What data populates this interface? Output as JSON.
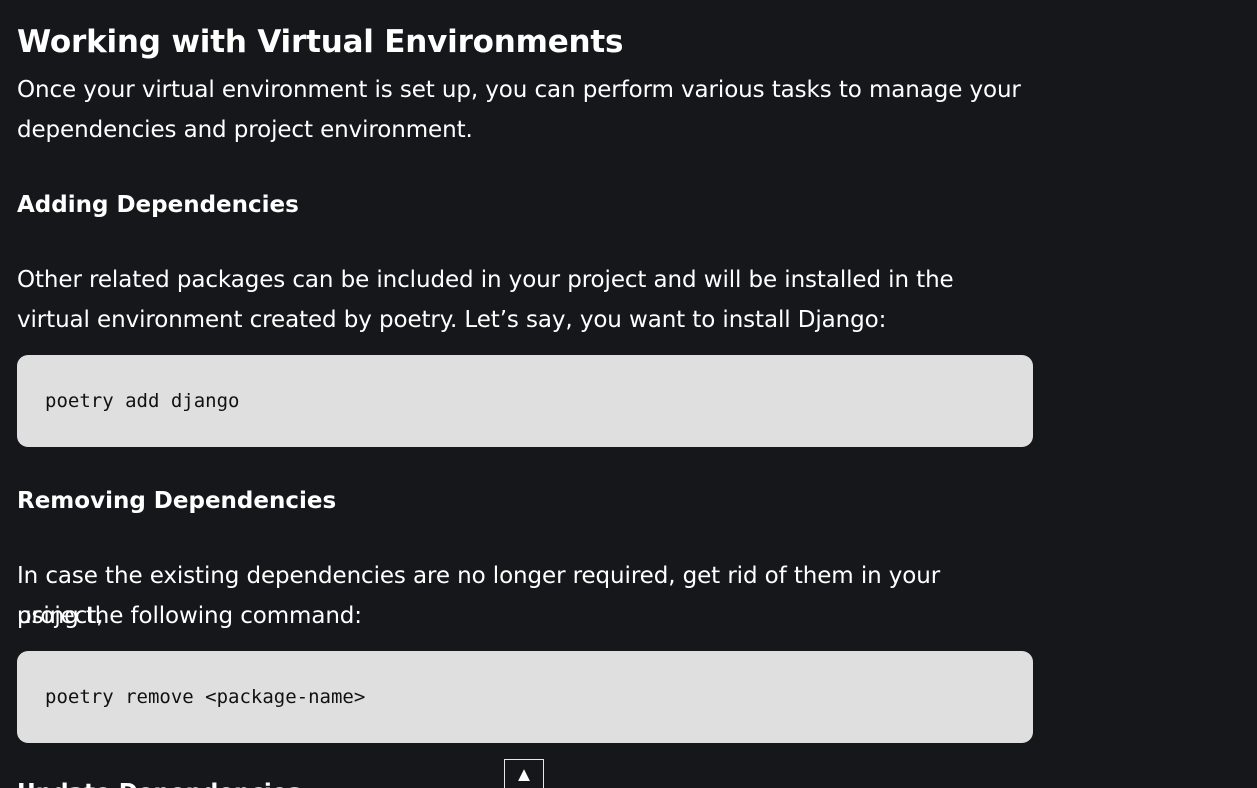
{
  "article": {
    "heading": "Working with Virtual Environments",
    "intro_line1": "Once your virtual environment is set up, you can perform various tasks to manage your",
    "intro_line2": "dependencies and project environment.",
    "sections": [
      {
        "title": "Adding Dependencies",
        "line1": "Other related packages can be included in your project and will be installed in the",
        "line2": "virtual environment created by poetry. Let’s say, you want to install Django:",
        "code": "poetry add django"
      },
      {
        "title": "Removing Dependencies",
        "line1": "In case the existing dependencies are no longer required, get rid of them in your project,",
        "line2": "using the following command:",
        "code": "poetry remove <package-name>"
      }
    ],
    "partial_heading": "Update Dependencies"
  },
  "scroll_top": {
    "glyph": "▲",
    "icon": "arrow-up-icon"
  },
  "colors": {
    "background": "#16171b",
    "text": "#ffffff",
    "code_background": "#dfdfdf",
    "code_text": "#111111"
  }
}
